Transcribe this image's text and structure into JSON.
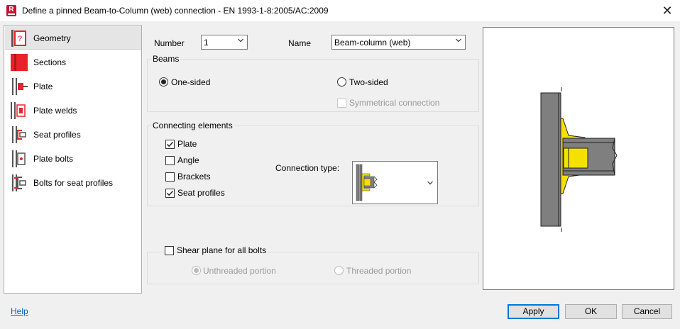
{
  "window": {
    "title": "Define a pinned Beam-to-Column (web) connection - EN 1993-1-8:2005/AC:2009",
    "app_icon_letter": "R",
    "close_glyph": "✕"
  },
  "nav": {
    "items": [
      {
        "label": "Geometry",
        "selected": true
      },
      {
        "label": "Sections"
      },
      {
        "label": "Plate"
      },
      {
        "label": "Plate welds"
      },
      {
        "label": "Seat profiles"
      },
      {
        "label": "Plate bolts"
      },
      {
        "label": "Bolts for seat profiles"
      }
    ]
  },
  "form": {
    "number_label": "Number",
    "number_value": "1",
    "name_label": "Name",
    "name_value": "Beam-column (web)"
  },
  "beams": {
    "title": "Beams",
    "one_sided": "One-sided",
    "two_sided": "Two-sided",
    "symmetrical": "Symmetrical connection",
    "selected": "One-sided"
  },
  "connecting": {
    "title": "Connecting elements",
    "items": [
      {
        "label": "Plate",
        "checked": true
      },
      {
        "label": "Angle",
        "checked": false
      },
      {
        "label": "Brackets",
        "checked": false
      },
      {
        "label": "Seat profiles",
        "checked": true
      }
    ],
    "connection_type_label": "Connection type:"
  },
  "shear": {
    "label": "Shear plane for all bolts",
    "checked": false,
    "unthreaded": "Unthreaded portion",
    "threaded": "Threaded portion",
    "selected": "Unthreaded portion"
  },
  "footer": {
    "help": "Help",
    "apply": "Apply",
    "ok": "OK",
    "cancel": "Cancel"
  },
  "colors": {
    "accent": "#0078d7",
    "steel": "#7f7f7f",
    "plate_yellow": "#f5e100",
    "icon_red": "#e8232a"
  }
}
